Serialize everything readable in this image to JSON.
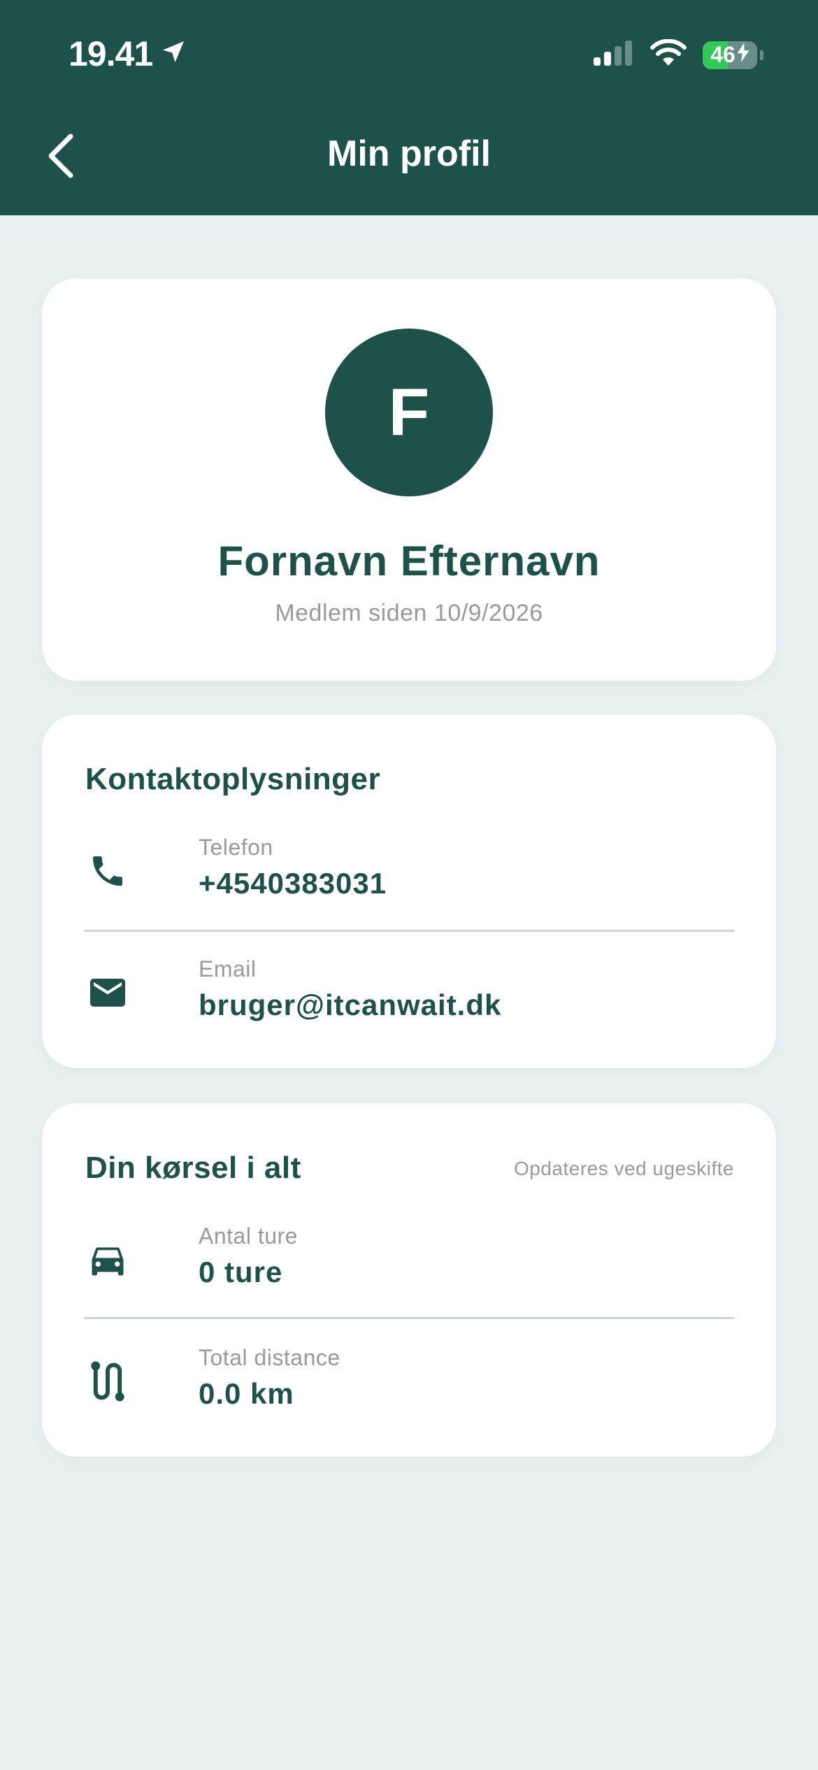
{
  "status_bar": {
    "time": "19.41",
    "battery_level": "46",
    "battery_fraction": 0.46
  },
  "header": {
    "title": "Min profil"
  },
  "profile": {
    "initial": "F",
    "name": "Fornavn Efternavn",
    "member_since": "Medlem siden 10/9/2026"
  },
  "contact": {
    "title": "Kontaktoplysninger",
    "items": [
      {
        "label": "Telefon",
        "value": "+4540383031",
        "icon": "phone-icon"
      },
      {
        "label": "Email",
        "value": "bruger@itcanwait.dk",
        "icon": "mail-icon"
      }
    ]
  },
  "driving": {
    "title": "Din kørsel i alt",
    "note": "Opdateres ved ugeskifte",
    "items": [
      {
        "label": "Antal ture",
        "value": "0 ture",
        "icon": "car-icon"
      },
      {
        "label": "Total distance",
        "value": "0.0 km",
        "icon": "route-icon"
      }
    ]
  },
  "colors": {
    "primary": "#1d514a",
    "background": "#e9f2f0",
    "card": "#ffffff",
    "muted_text": "#9a9a9a",
    "battery_green": "#34c759"
  }
}
